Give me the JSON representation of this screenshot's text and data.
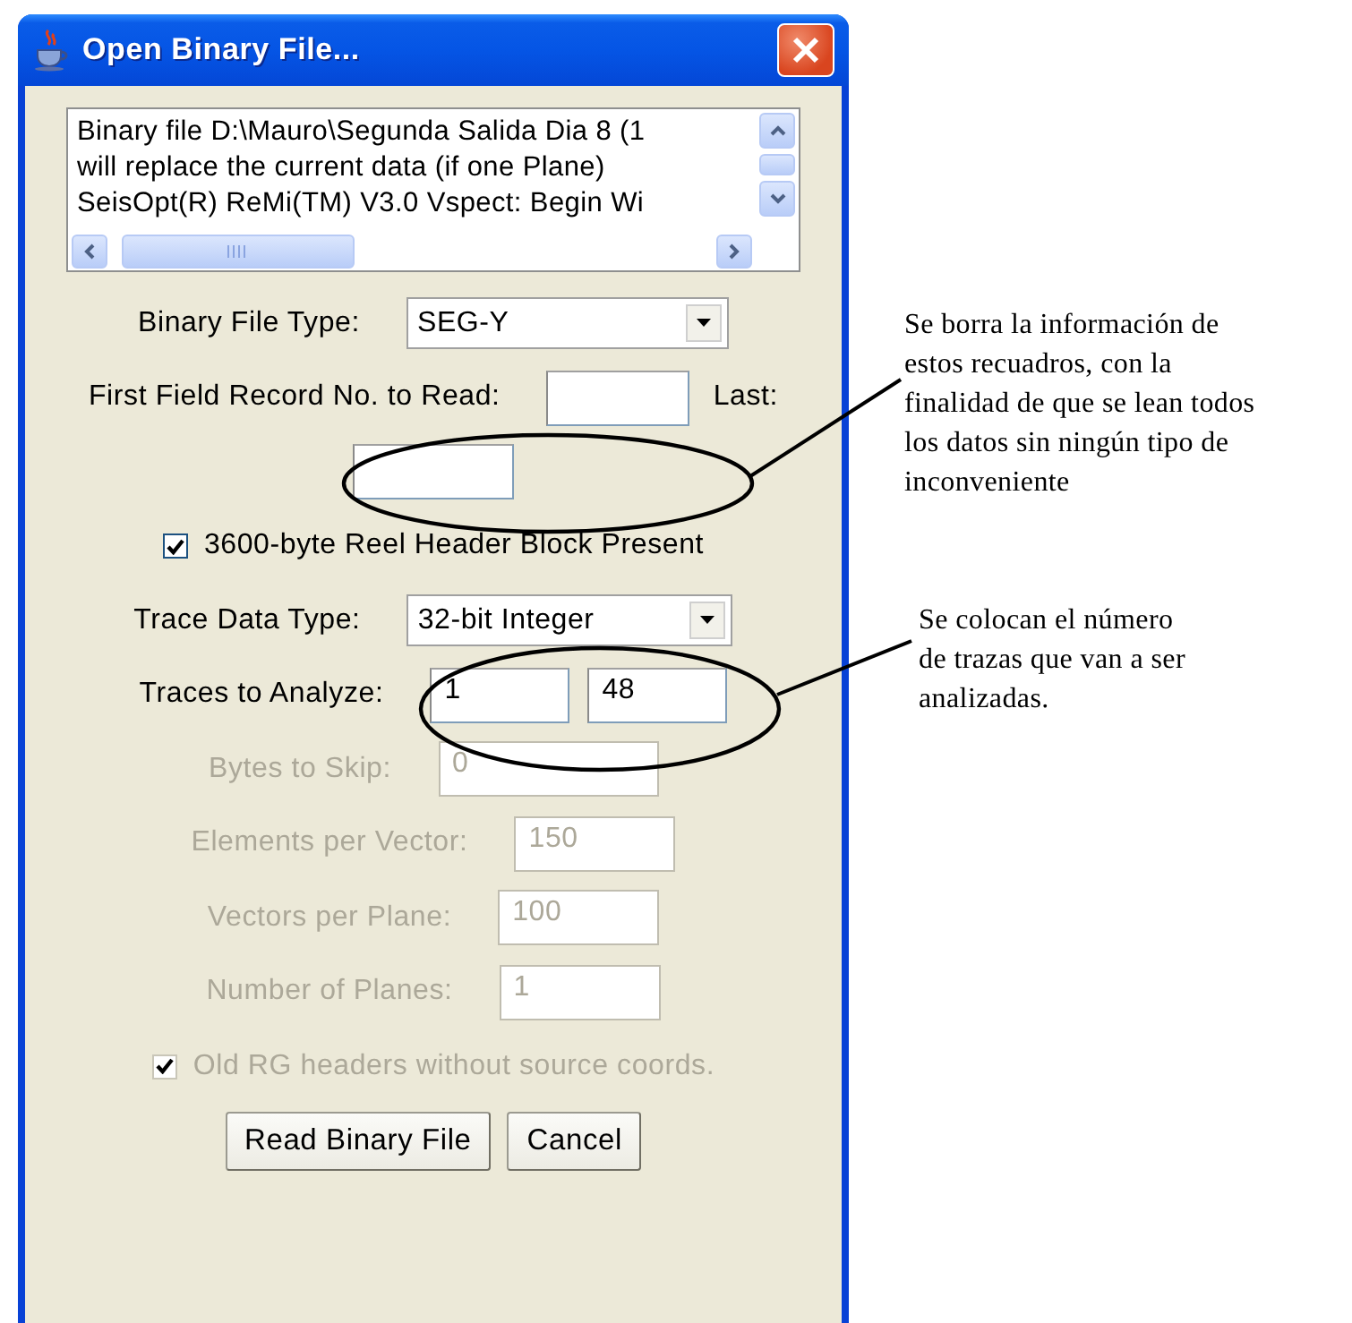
{
  "window": {
    "title": "Open Binary File..."
  },
  "log": {
    "lines": [
      "Binary file D:\\Mauro\\Segunda Salida Dia 8 (1",
      "will replace the current data (if one Plane)",
      "SeisOpt(R) ReMi(TM) V3.0 Vspect: Begin Wi"
    ]
  },
  "fields": [
    {
      "kind": "select",
      "label": "Binary File Type:",
      "value": "SEG-Y",
      "disabled": false
    },
    {
      "kind": "record_range",
      "label": "First Field Record No. to Read:",
      "last_label": "Last:",
      "disabled": false
    },
    {
      "kind": "checkbox",
      "label": "3600-byte Reel Header Block Present",
      "checked": true,
      "disabled": false
    },
    {
      "kind": "select",
      "label": "Trace Data Type:",
      "value": "32-bit Integer",
      "disabled": false
    },
    {
      "kind": "pair",
      "label": "Traces to Analyze:",
      "values": [
        "1",
        "48"
      ],
      "disabled": false
    },
    {
      "kind": "text",
      "label": "Bytes to Skip:",
      "value": "0",
      "disabled": true
    },
    {
      "kind": "text",
      "label": "Elements per Vector:",
      "value": "150",
      "disabled": true
    },
    {
      "kind": "text",
      "label": "Vectors per Plane:",
      "value": "100",
      "disabled": true
    },
    {
      "kind": "text",
      "label": "Number of Planes:",
      "value": "1",
      "disabled": true
    },
    {
      "kind": "checkbox",
      "label": "Old RG headers without source coords.",
      "checked": true,
      "disabled": true
    }
  ],
  "buttons": [
    "Read Binary File",
    "Cancel"
  ],
  "notes": [
    {
      "lines": [
        "Se borra la información de",
        "estos recuadros, con la",
        "finalidad de que se lean todos",
        "los datos sin ningún tipo de",
        "inconveniente"
      ]
    },
    {
      "lines": [
        "Se colocan el número",
        "de trazas que van a ser",
        "analizadas."
      ]
    }
  ]
}
